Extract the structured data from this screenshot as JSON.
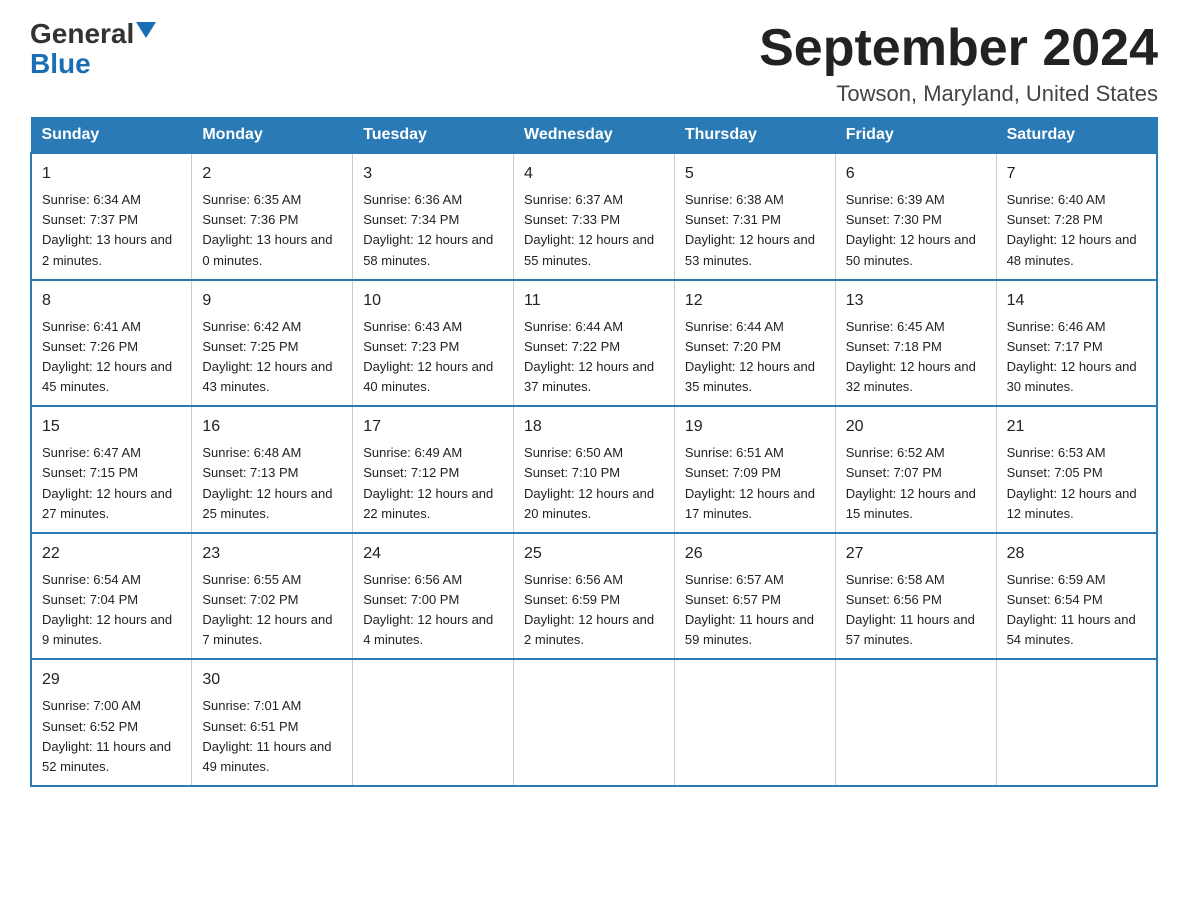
{
  "header": {
    "logo_general": "General",
    "logo_blue": "Blue",
    "month_title": "September 2024",
    "location": "Towson, Maryland, United States"
  },
  "days_of_week": [
    "Sunday",
    "Monday",
    "Tuesday",
    "Wednesday",
    "Thursday",
    "Friday",
    "Saturday"
  ],
  "weeks": [
    [
      {
        "day": "1",
        "sunrise": "6:34 AM",
        "sunset": "7:37 PM",
        "daylight": "13 hours and 2 minutes."
      },
      {
        "day": "2",
        "sunrise": "6:35 AM",
        "sunset": "7:36 PM",
        "daylight": "13 hours and 0 minutes."
      },
      {
        "day": "3",
        "sunrise": "6:36 AM",
        "sunset": "7:34 PM",
        "daylight": "12 hours and 58 minutes."
      },
      {
        "day": "4",
        "sunrise": "6:37 AM",
        "sunset": "7:33 PM",
        "daylight": "12 hours and 55 minutes."
      },
      {
        "day": "5",
        "sunrise": "6:38 AM",
        "sunset": "7:31 PM",
        "daylight": "12 hours and 53 minutes."
      },
      {
        "day": "6",
        "sunrise": "6:39 AM",
        "sunset": "7:30 PM",
        "daylight": "12 hours and 50 minutes."
      },
      {
        "day": "7",
        "sunrise": "6:40 AM",
        "sunset": "7:28 PM",
        "daylight": "12 hours and 48 minutes."
      }
    ],
    [
      {
        "day": "8",
        "sunrise": "6:41 AM",
        "sunset": "7:26 PM",
        "daylight": "12 hours and 45 minutes."
      },
      {
        "day": "9",
        "sunrise": "6:42 AM",
        "sunset": "7:25 PM",
        "daylight": "12 hours and 43 minutes."
      },
      {
        "day": "10",
        "sunrise": "6:43 AM",
        "sunset": "7:23 PM",
        "daylight": "12 hours and 40 minutes."
      },
      {
        "day": "11",
        "sunrise": "6:44 AM",
        "sunset": "7:22 PM",
        "daylight": "12 hours and 37 minutes."
      },
      {
        "day": "12",
        "sunrise": "6:44 AM",
        "sunset": "7:20 PM",
        "daylight": "12 hours and 35 minutes."
      },
      {
        "day": "13",
        "sunrise": "6:45 AM",
        "sunset": "7:18 PM",
        "daylight": "12 hours and 32 minutes."
      },
      {
        "day": "14",
        "sunrise": "6:46 AM",
        "sunset": "7:17 PM",
        "daylight": "12 hours and 30 minutes."
      }
    ],
    [
      {
        "day": "15",
        "sunrise": "6:47 AM",
        "sunset": "7:15 PM",
        "daylight": "12 hours and 27 minutes."
      },
      {
        "day": "16",
        "sunrise": "6:48 AM",
        "sunset": "7:13 PM",
        "daylight": "12 hours and 25 minutes."
      },
      {
        "day": "17",
        "sunrise": "6:49 AM",
        "sunset": "7:12 PM",
        "daylight": "12 hours and 22 minutes."
      },
      {
        "day": "18",
        "sunrise": "6:50 AM",
        "sunset": "7:10 PM",
        "daylight": "12 hours and 20 minutes."
      },
      {
        "day": "19",
        "sunrise": "6:51 AM",
        "sunset": "7:09 PM",
        "daylight": "12 hours and 17 minutes."
      },
      {
        "day": "20",
        "sunrise": "6:52 AM",
        "sunset": "7:07 PM",
        "daylight": "12 hours and 15 minutes."
      },
      {
        "day": "21",
        "sunrise": "6:53 AM",
        "sunset": "7:05 PM",
        "daylight": "12 hours and 12 minutes."
      }
    ],
    [
      {
        "day": "22",
        "sunrise": "6:54 AM",
        "sunset": "7:04 PM",
        "daylight": "12 hours and 9 minutes."
      },
      {
        "day": "23",
        "sunrise": "6:55 AM",
        "sunset": "7:02 PM",
        "daylight": "12 hours and 7 minutes."
      },
      {
        "day": "24",
        "sunrise": "6:56 AM",
        "sunset": "7:00 PM",
        "daylight": "12 hours and 4 minutes."
      },
      {
        "day": "25",
        "sunrise": "6:56 AM",
        "sunset": "6:59 PM",
        "daylight": "12 hours and 2 minutes."
      },
      {
        "day": "26",
        "sunrise": "6:57 AM",
        "sunset": "6:57 PM",
        "daylight": "11 hours and 59 minutes."
      },
      {
        "day": "27",
        "sunrise": "6:58 AM",
        "sunset": "6:56 PM",
        "daylight": "11 hours and 57 minutes."
      },
      {
        "day": "28",
        "sunrise": "6:59 AM",
        "sunset": "6:54 PM",
        "daylight": "11 hours and 54 minutes."
      }
    ],
    [
      {
        "day": "29",
        "sunrise": "7:00 AM",
        "sunset": "6:52 PM",
        "daylight": "11 hours and 52 minutes."
      },
      {
        "day": "30",
        "sunrise": "7:01 AM",
        "sunset": "6:51 PM",
        "daylight": "11 hours and 49 minutes."
      },
      null,
      null,
      null,
      null,
      null
    ]
  ]
}
